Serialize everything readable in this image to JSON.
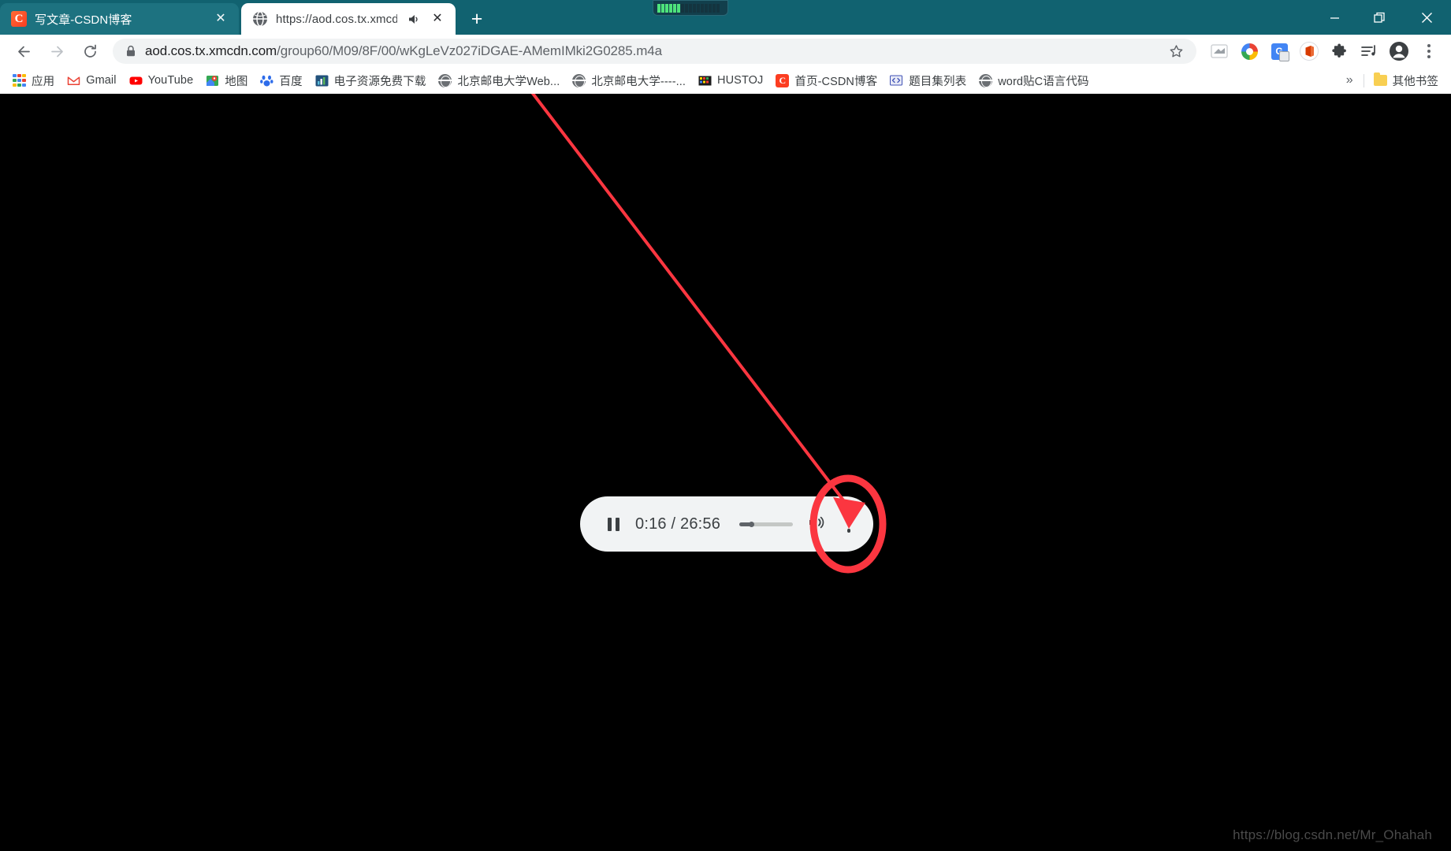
{
  "window": {
    "chrome_color": "#116270",
    "controls": [
      {
        "name": "minimize",
        "glyph": "—"
      },
      {
        "name": "restore",
        "glyph": "❐"
      },
      {
        "name": "close",
        "glyph": "✕"
      }
    ],
    "perf_widget": {
      "bars_total": 16,
      "bars_active": 6,
      "active_color": "#4ee37b"
    }
  },
  "tabs": [
    {
      "title": "写文章-CSDN博客",
      "favicon": "csdn-favicon",
      "active": false,
      "audio": false,
      "close_glyph": "✕"
    },
    {
      "title": "https://aod.cos.tx.xmcdn.c",
      "favicon": "globe-favicon",
      "active": true,
      "audio": true,
      "close_glyph": "✕"
    }
  ],
  "newtab_label": "+",
  "toolbar": {
    "back_label": "←",
    "forward_label": "→",
    "reload_label": "⟳",
    "url_domain": "aod.cos.tx.xmcdn.com",
    "url_path": "/group60/M09/8F/00/wKgLeVz027iDGAE-AMemIMki2G0285.m4a",
    "url_full": "aod.cos.tx.xmcdn.com/group60/M09/8F/00/wKgLeVz027iDGAE-AMemIMki2G0285.m4a",
    "star_glyph": "☆",
    "gt_letter": "G",
    "icons": [
      "extension-grey-icon",
      "color-ring-icon",
      "google-translate-icon",
      "office-icon",
      "puzzle-extensions-icon",
      "media-playlist-icon",
      "profile-avatar-icon",
      "chrome-menu-icon"
    ]
  },
  "bookmarks": {
    "items": [
      {
        "label": "应用",
        "icon": "apps-grid-icon"
      },
      {
        "label": "Gmail",
        "icon": "gmail-icon"
      },
      {
        "label": "YouTube",
        "icon": "youtube-icon"
      },
      {
        "label": "地图",
        "icon": "maps-icon"
      },
      {
        "label": "百度",
        "icon": "baidu-icon"
      },
      {
        "label": "电子资源免费下载",
        "icon": "chart-icon"
      },
      {
        "label": "北京邮电大学Web...",
        "icon": "globe-icon"
      },
      {
        "label": "北京邮电大学----...",
        "icon": "globe-icon"
      },
      {
        "label": "HUSTOJ",
        "icon": "hustoj-icon"
      },
      {
        "label": "首页-CSDN博客",
        "icon": "csdn-icon"
      },
      {
        "label": "题目集列表",
        "icon": "code-icon"
      },
      {
        "label": "word贴C语言代码",
        "icon": "globe-icon"
      }
    ],
    "overflow_glyph": "»",
    "other_bookmarks_label": "其他书签"
  },
  "player": {
    "state": "playing",
    "pause_icon": "pause-icon",
    "time_display": "0:16 / 26:56",
    "current_time": "0:16",
    "duration": "26:56",
    "progress_percent": 24,
    "volume_icon": "volume-on-icon",
    "menu_icon": "more-options-icon"
  },
  "annotation": {
    "color": "#fb3640",
    "shape": "ellipse-with-arrow",
    "target": "player-more-options-button"
  },
  "watermark": "https://blog.csdn.net/Mr_Ohahah"
}
